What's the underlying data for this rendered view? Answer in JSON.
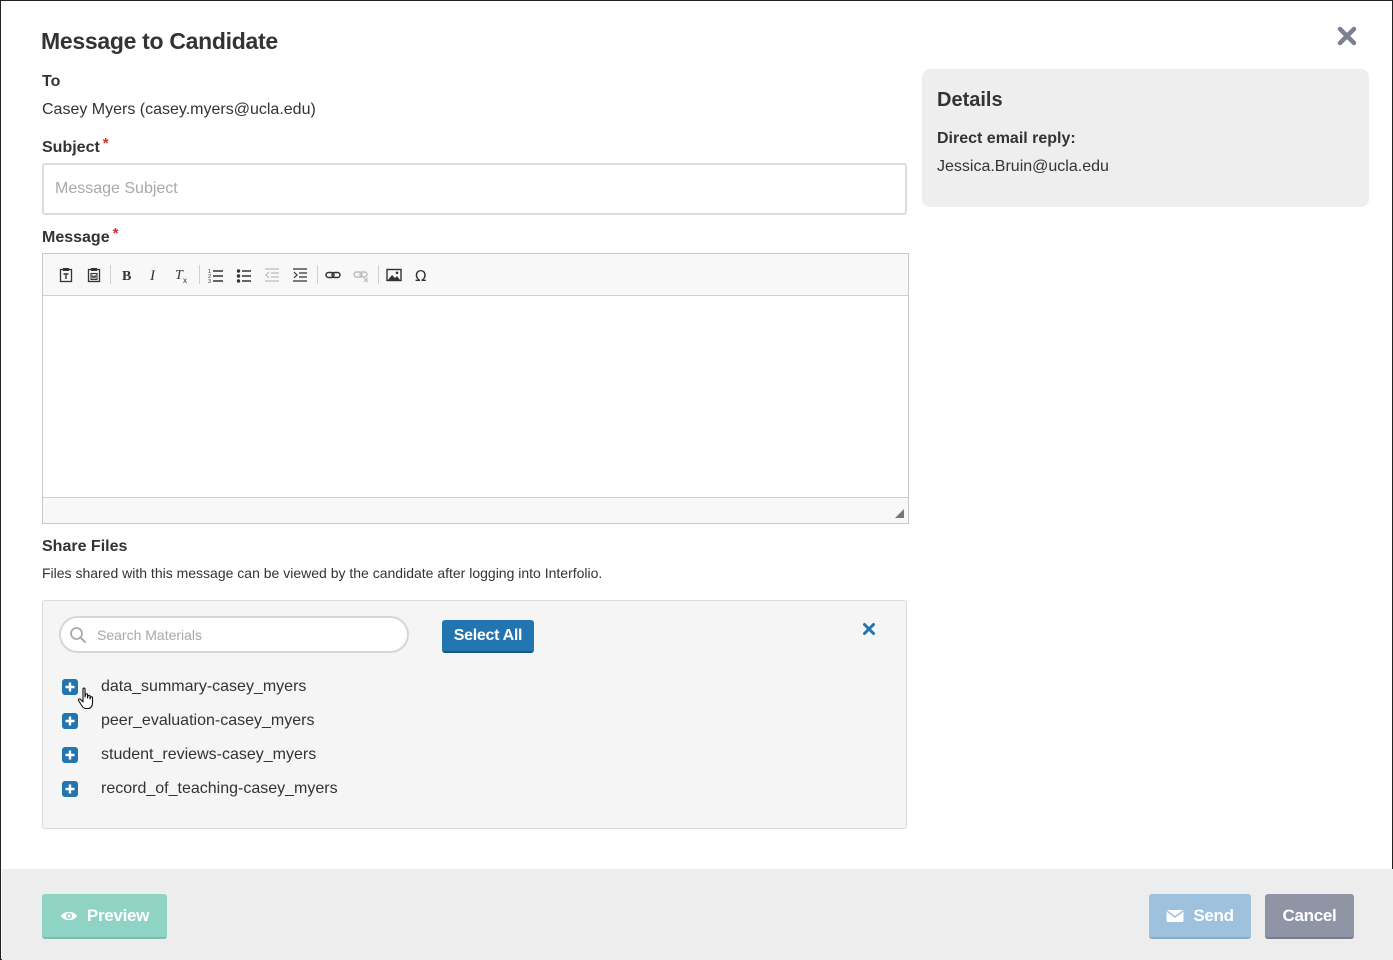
{
  "modal": {
    "title": "Message to Candidate"
  },
  "to": {
    "label": "To",
    "value": "Casey Myers (casey.myers@ucla.edu)"
  },
  "subject": {
    "label": "Subject",
    "required_mark": "*",
    "placeholder": "Message Subject",
    "value": ""
  },
  "message": {
    "label": "Message",
    "required_mark": "*",
    "toolbar": [
      {
        "name": "paste-text-icon"
      },
      {
        "name": "paste-from-word-icon"
      },
      {
        "name": "bold-icon"
      },
      {
        "name": "italic-icon"
      },
      {
        "name": "remove-format-icon"
      },
      {
        "name": "numbered-list-icon"
      },
      {
        "name": "bulleted-list-icon"
      },
      {
        "name": "outdent-icon"
      },
      {
        "name": "indent-icon"
      },
      {
        "name": "link-icon"
      },
      {
        "name": "unlink-icon"
      },
      {
        "name": "image-icon"
      },
      {
        "name": "special-character-icon"
      }
    ]
  },
  "details": {
    "title": "Details",
    "reply_label": "Direct email reply:",
    "reply_value": "Jessica.Bruin@ucla.edu"
  },
  "share_files": {
    "label": "Share Files",
    "description": "Files shared with this message can be viewed by the candidate after logging into Interfolio.",
    "search_placeholder": "Search Materials",
    "select_all_label": "Select All",
    "files": [
      {
        "name": "data_summary-casey_myers"
      },
      {
        "name": "peer_evaluation-casey_myers"
      },
      {
        "name": "student_reviews-casey_myers"
      },
      {
        "name": "record_of_teaching-casey_myers"
      }
    ]
  },
  "footer": {
    "preview_label": "Preview",
    "send_label": "Send",
    "cancel_label": "Cancel"
  },
  "colors": {
    "primary": "#2275b0",
    "preview": "#8fd3c5",
    "send": "#9ec1dd",
    "cancel": "#8f95a4",
    "required": "#d0312d"
  }
}
